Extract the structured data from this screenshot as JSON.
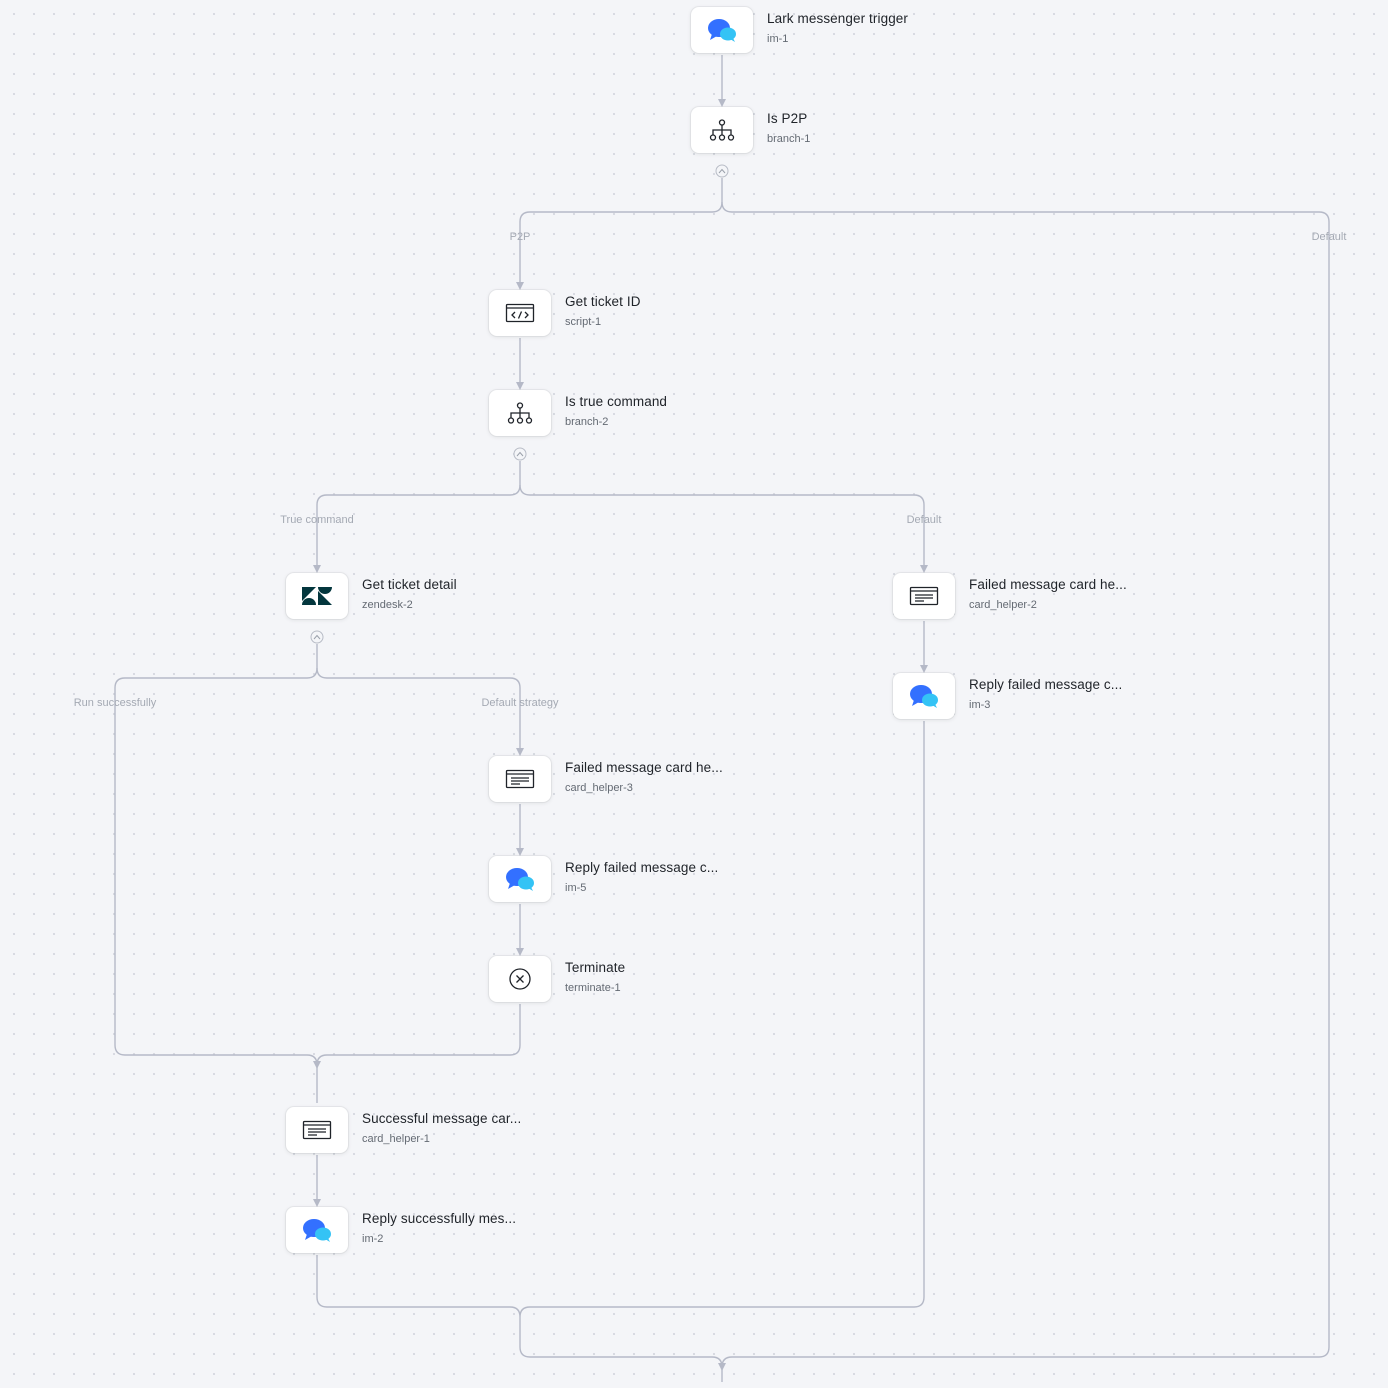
{
  "nodes": {
    "im1": {
      "title": "Lark messenger trigger",
      "id": "im-1",
      "icon": "lark-messenger-icon"
    },
    "branch1": {
      "title": "Is P2P",
      "id": "branch-1",
      "icon": "branch-icon"
    },
    "script1": {
      "title": "Get ticket ID",
      "id": "script-1",
      "icon": "code-icon"
    },
    "branch2": {
      "title": "Is true command",
      "id": "branch-2",
      "icon": "branch-icon"
    },
    "zendesk2": {
      "title": "Get ticket detail",
      "id": "zendesk-2",
      "icon": "zendesk-icon"
    },
    "card2": {
      "title": "Failed message card he...",
      "id": "card_helper-2",
      "icon": "card-icon"
    },
    "im3": {
      "title": "Reply failed message c...",
      "id": "im-3",
      "icon": "lark-messenger-icon"
    },
    "card3": {
      "title": "Failed message card he...",
      "id": "card_helper-3",
      "icon": "card-icon"
    },
    "im5": {
      "title": "Reply failed message c...",
      "id": "im-5",
      "icon": "lark-messenger-icon"
    },
    "terminate1": {
      "title": "Terminate",
      "id": "terminate-1",
      "icon": "terminate-icon"
    },
    "card1": {
      "title": "Successful message car...",
      "id": "card_helper-1",
      "icon": "card-icon"
    },
    "im2": {
      "title": "Reply successfully mes...",
      "id": "im-2",
      "icon": "lark-messenger-icon"
    }
  },
  "edge_labels": {
    "p2p": "P2P",
    "default_1": "Default",
    "true_command": "True command",
    "default_2": "Default",
    "run_successfully": "Run successfully",
    "default_strategy": "Default strategy"
  },
  "colors": {
    "edge": "#b5b9c7",
    "lark_blue": "#3370ff",
    "lark_cyan": "#34c3f5",
    "zendesk": "#03363d"
  }
}
